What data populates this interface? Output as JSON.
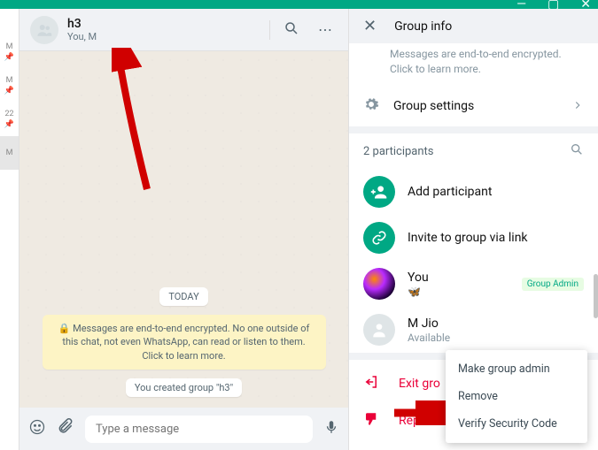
{
  "titlebar": {
    "min": "—",
    "max": "▢",
    "close": "✕"
  },
  "chat": {
    "title": "h3",
    "subtitle": "You, M",
    "search_icon": "⌕",
    "more_icon": "⋯",
    "date_pill": "TODAY",
    "encryption_notice": "🔒 Messages are end-to-end encrypted. No one outside of this chat, not even WhatsApp, can read or listen to them. Click to learn more.",
    "system_msg": "You created group \"h3\"",
    "composer": {
      "emoji": "☺",
      "attach": "📎",
      "placeholder": "Type a message",
      "mic": "🎤"
    }
  },
  "panel": {
    "title": "Group info",
    "close": "✕",
    "encrypt_text": "Messages are end-to-end encrypted. Click to learn more.",
    "group_settings": "Group settings",
    "participants_label": "2 participants",
    "add_participant": "Add participant",
    "invite_link": "Invite to group via link",
    "you": {
      "name": "You",
      "status": "🦋",
      "badge": "Group Admin"
    },
    "mjio": {
      "name": "M Jio",
      "status": "Available"
    },
    "exit": "Exit gro",
    "report": "Report"
  },
  "context_menu": {
    "make_admin": "Make group admin",
    "remove": "Remove",
    "verify": "Verify Security Code"
  },
  "sidebar": {
    "items": [
      {
        "label": "M",
        "pin": "📌"
      },
      {
        "label": "M",
        "pin": "📌"
      },
      {
        "label": "22",
        "pin": "📌"
      },
      {
        "label": "M",
        "pin": ""
      }
    ]
  }
}
